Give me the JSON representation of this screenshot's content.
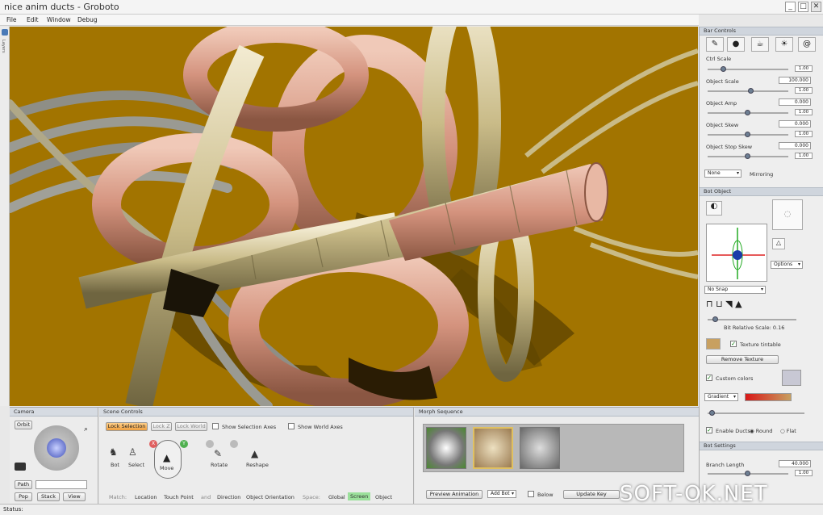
{
  "window": {
    "title": "nice anim ducts - Groboto",
    "minimize": "_",
    "maximize": "□",
    "close": "✕"
  },
  "menu": [
    "File",
    "Edit",
    "Window",
    "Debug"
  ],
  "left_tab": "Layers",
  "right": {
    "header": "Bar Controls",
    "rows": [
      {
        "label": "Ctrl Scale",
        "value": "1.00"
      },
      {
        "label": "Object Scale",
        "value": "100.000",
        "small": "1.00"
      },
      {
        "label": "Object Amp",
        "value": "0.000",
        "small": "1.00"
      },
      {
        "label": "Object Skew",
        "value": "0.000",
        "small": "1.00"
      },
      {
        "label": "Object Stop Skew",
        "value": "0.000",
        "small": "1.00"
      }
    ],
    "mirror_select": "None",
    "mirroring": "Mirroring",
    "bot_object_header": "Bot Object",
    "options_select": "Options",
    "snap_select": "No Snap",
    "relative_scale": "Bit Relative Scale: 0.16",
    "texture_tinted": "Texture tintable",
    "remove_texture": "Remove Texture",
    "custom_colors": "Custom colors",
    "gradient_select": "Gradient",
    "enable_ducts": "Enable Ducts",
    "round": "Round",
    "flat": "Flat",
    "bot_settings_header": "Bot Settings",
    "branch_length": "Branch Length",
    "branch_value": "40.000",
    "branch_small": "1.00",
    "accent_gradient": [
      "#d81818",
      "#c8a060"
    ]
  },
  "camera": {
    "header": "Camera",
    "orbit": "Orbit",
    "path": "Path",
    "pop": "Pop",
    "stack": "Stack",
    "view": "View"
  },
  "scene": {
    "header": "Scene Controls",
    "lock_selection": "Lock Selection",
    "lock_z": "Lock Z",
    "lock_world": "Lock World",
    "show_selection_axes": "Show Selection Axes",
    "show_world_axes": "Show World Axes",
    "tools": [
      "Bot",
      "Select",
      "Move",
      "Rotate",
      "Reshape"
    ],
    "bottom": [
      "Match:",
      "Location",
      "Touch Point",
      "and",
      "Direction",
      "Object Orientation",
      "Space:",
      "Global",
      "Screen",
      "Object"
    ]
  },
  "morph": {
    "header": "Morph Sequence",
    "preview": "Preview Animation",
    "add_bot": "Add Bot",
    "below": "Below",
    "update_key": "Update Key"
  },
  "status": "Status:",
  "watermark": "SOFT-OK.NET"
}
